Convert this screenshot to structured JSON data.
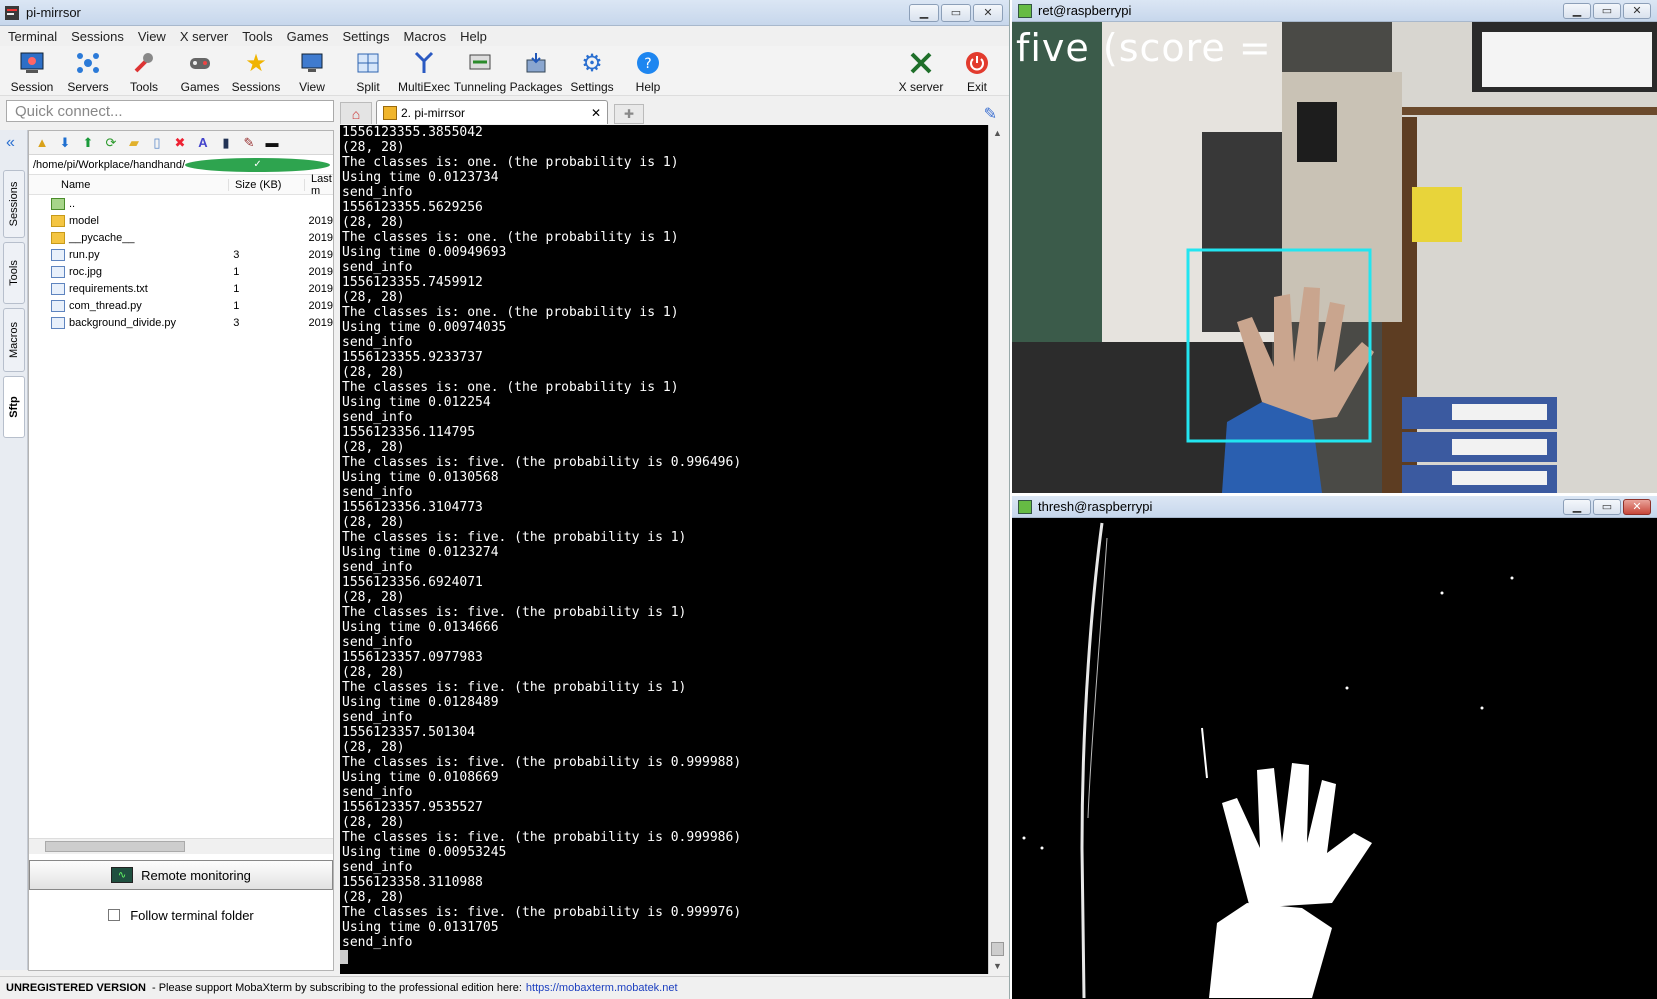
{
  "main_window": {
    "title": "pi-mirrsor",
    "menu": [
      "Terminal",
      "Sessions",
      "View",
      "X server",
      "Tools",
      "Games",
      "Settings",
      "Macros",
      "Help"
    ],
    "toolbar": [
      {
        "label": "Session",
        "icon": "session-icon"
      },
      {
        "label": "Servers",
        "icon": "servers-icon"
      },
      {
        "label": "Tools",
        "icon": "tools-icon"
      },
      {
        "label": "Games",
        "icon": "games-icon"
      },
      {
        "label": "Sessions",
        "icon": "sessions-star-icon"
      },
      {
        "label": "View",
        "icon": "view-icon"
      },
      {
        "label": "Split",
        "icon": "split-icon"
      },
      {
        "label": "MultiExec",
        "icon": "multiexec-icon"
      },
      {
        "label": "Tunneling",
        "icon": "tunneling-icon"
      },
      {
        "label": "Packages",
        "icon": "packages-icon"
      },
      {
        "label": "Settings",
        "icon": "settings-icon"
      },
      {
        "label": "Help",
        "icon": "help-icon"
      }
    ],
    "toolbar_right": [
      {
        "label": "X server",
        "icon": "xserver-icon"
      },
      {
        "label": "Exit",
        "icon": "exit-icon"
      }
    ],
    "quick_connect_placeholder": "Quick connect...",
    "tab_label": "2. pi-mirrsor",
    "side_tabs": [
      "Sessions",
      "Tools",
      "Macros",
      "Sftp"
    ]
  },
  "sftp": {
    "path": "/home/pi/Workplace/handhand/",
    "columns": [
      "Name",
      "Size (KB)",
      "Last m"
    ],
    "files": [
      {
        "name": "..",
        "size": "",
        "date": "",
        "kind": "up"
      },
      {
        "name": "model",
        "size": "",
        "date": "2019",
        "kind": "folder"
      },
      {
        "name": "__pycache__",
        "size": "",
        "date": "2019",
        "kind": "folder"
      },
      {
        "name": "run.py",
        "size": "3",
        "date": "2019",
        "kind": "file"
      },
      {
        "name": "roc.jpg",
        "size": "1",
        "date": "2019",
        "kind": "file"
      },
      {
        "name": "requirements.txt",
        "size": "1",
        "date": "2019",
        "kind": "file"
      },
      {
        "name": "com_thread.py",
        "size": "1",
        "date": "2019",
        "kind": "file"
      },
      {
        "name": "background_divide.py",
        "size": "3",
        "date": "2019",
        "kind": "file"
      }
    ],
    "remote_monitoring": "Remote monitoring",
    "follow_terminal": "Follow terminal folder"
  },
  "terminal": {
    "lines": [
      "1556123355.3855042",
      "(28, 28)",
      "The classes is: one. (the probability is 1)",
      "Using time 0.0123734",
      "send_info",
      "1556123355.5629256",
      "(28, 28)",
      "The classes is: one. (the probability is 1)",
      "Using time 0.00949693",
      "send_info",
      "1556123355.7459912",
      "(28, 28)",
      "The classes is: one. (the probability is 1)",
      "Using time 0.00974035",
      "send_info",
      "1556123355.9233737",
      "(28, 28)",
      "The classes is: one. (the probability is 1)",
      "Using time 0.012254",
      "send_info",
      "1556123356.114795",
      "(28, 28)",
      "The classes is: five. (the probability is 0.996496)",
      "Using time 0.0130568",
      "send_info",
      "1556123356.3104773",
      "(28, 28)",
      "The classes is: five. (the probability is 1)",
      "Using time 0.0123274",
      "send_info",
      "1556123356.6924071",
      "(28, 28)",
      "The classes is: five. (the probability is 1)",
      "Using time 0.0134666",
      "send_info",
      "1556123357.0977983",
      "(28, 28)",
      "The classes is: five. (the probability is 1)",
      "Using time 0.0128489",
      "send_info",
      "1556123357.501304",
      "(28, 28)",
      "The classes is: five. (the probability is 0.999988)",
      "Using time 0.0108669",
      "send_info",
      "1556123357.9535527",
      "(28, 28)",
      "The classes is: five. (the probability is 0.999986)",
      "Using time 0.00953245",
      "send_info",
      "1556123358.3110988",
      "(28, 28)",
      "The classes is: five. (the probability is 0.999976)",
      "Using time 0.0131705",
      "send_info"
    ]
  },
  "status": {
    "unregistered": "UNREGISTERED VERSION",
    "message": "-  Please support MobaXterm by subscribing to the professional edition here:",
    "link": "https://mobaxterm.mobatek.net"
  },
  "ret_window": {
    "title": "ret@raspberrypi",
    "overlay": "five (score ="
  },
  "thresh_window": {
    "title": "thresh@raspberrypi"
  },
  "colors": {
    "detect_box": "#22e5f0",
    "terminal_bg": "#000000",
    "terminal_fg": "#ffffff"
  }
}
